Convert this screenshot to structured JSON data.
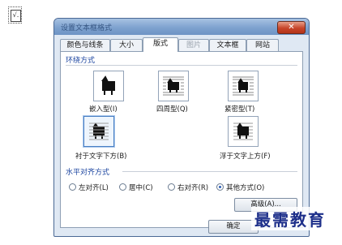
{
  "app_icon": {
    "name": "formula-icon",
    "glyph": "√."
  },
  "dialog": {
    "title": "设置文本框格式",
    "close_glyph": "✕",
    "tabs": [
      {
        "label": "颜色与线条"
      },
      {
        "label": "大小"
      },
      {
        "label": "版式",
        "active": true
      },
      {
        "label": "图片",
        "disabled": true
      },
      {
        "label": "文本框"
      },
      {
        "label": "网站"
      }
    ],
    "wrap_section": {
      "title": "环绕方式",
      "options": [
        {
          "label": "嵌入型(I)",
          "icon": "inline-wrap-icon"
        },
        {
          "label": "四周型(Q)",
          "icon": "square-wrap-icon"
        },
        {
          "label": "紧密型(T)",
          "icon": "tight-wrap-icon"
        },
        {
          "label": "衬于文字下方(B)",
          "icon": "behind-text-icon",
          "selected": true
        },
        {
          "label": "浮于文字上方(F)",
          "icon": "in-front-of-text-icon"
        }
      ]
    },
    "align_section": {
      "title": "水平对齐方式",
      "options": [
        {
          "label": "左对齐(L)",
          "checked": false
        },
        {
          "label": "居中(C)",
          "checked": false
        },
        {
          "label": "右对齐(R)",
          "checked": false
        },
        {
          "label": "其他方式(O)",
          "checked": true
        }
      ]
    },
    "buttons": {
      "advanced": "高级(A)...",
      "ok": "确定"
    }
  },
  "watermark": "最需教育"
}
